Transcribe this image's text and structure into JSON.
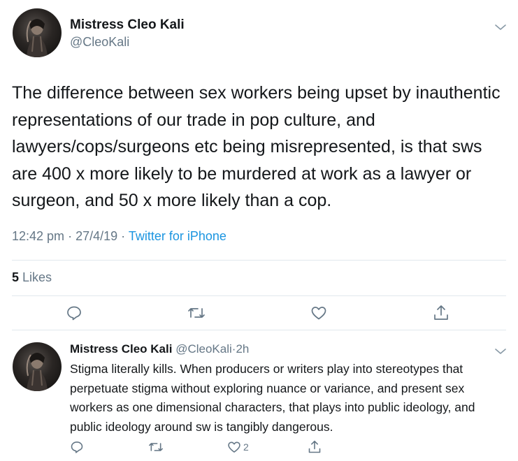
{
  "main_tweet": {
    "author_name": "Mistress Cleo Kali",
    "author_handle": "@CleoKali",
    "text": "The difference between sex workers being upset by inauthentic representations of our trade in pop culture, and lawyers/cops/surgeons etc being misrepresented, is that sws are 400 x more likely to be murdered at work as a lawyer or surgeon, and 50 x more likely than a cop.",
    "time": "12:42 pm",
    "date": "27/4/19",
    "separator": "·",
    "source": "Twitter for iPhone",
    "likes_count": "5",
    "likes_label": "Likes",
    "actions": {
      "reply_icon": "reply-icon",
      "retweet_icon": "retweet-icon",
      "like_icon": "heart-icon",
      "share_icon": "share-icon"
    }
  },
  "reply_tweet": {
    "author_name": "Mistress Cleo Kali",
    "author_handle": "@CleoKali",
    "dot": "·",
    "time_ago": "2h",
    "text": "Stigma literally kills. When producers or writers play into stereotypes that perpetuate stigma without exploring nuance or variance, and present sex workers as one dimensional characters, that plays into public ideology, and public ideology around sw is tangibly dangerous.",
    "like_count": "2"
  },
  "colors": {
    "text": "#14171a",
    "secondary": "#657786",
    "link": "#1b95e0",
    "divider": "#e1e8ed"
  }
}
